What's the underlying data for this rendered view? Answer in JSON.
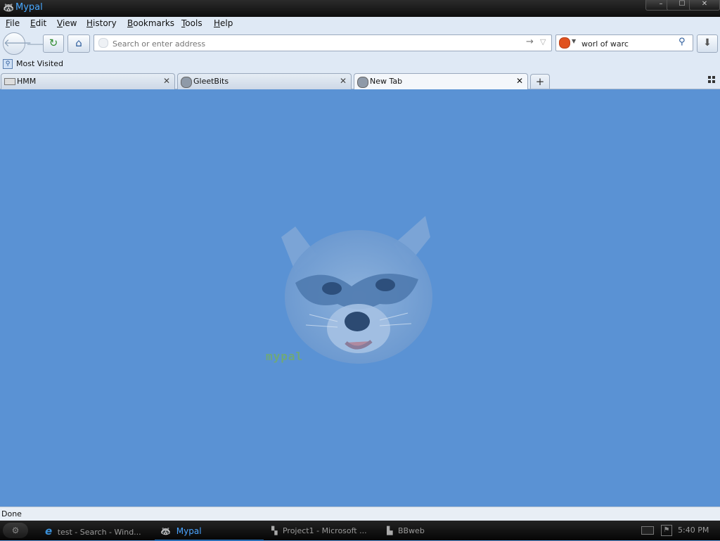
{
  "window": {
    "title": "Mypal",
    "controls": {
      "minimize": "–",
      "maximize": "☐",
      "close": "✕"
    }
  },
  "menubar": {
    "items": [
      {
        "label": "File",
        "accel": "F",
        "rest": "ile"
      },
      {
        "label": "Edit",
        "accel": "E",
        "rest": "dit"
      },
      {
        "label": "View",
        "accel": "V",
        "rest": "iew"
      },
      {
        "label": "History",
        "accel": "H",
        "rest": "istory"
      },
      {
        "label": "Bookmarks",
        "accel": "B",
        "rest": "ookmarks"
      },
      {
        "label": "Tools",
        "accel": "T",
        "rest": "ools"
      },
      {
        "label": "Help",
        "accel": "H",
        "rest": "elp"
      }
    ]
  },
  "toolbar": {
    "back_icon": "back-arrow-icon",
    "forward_icon": "forward-arrow-icon",
    "reload_icon": "reload-icon",
    "home_icon": "home-icon",
    "download_icon": "download-icon"
  },
  "urlbar": {
    "placeholder": "Search or enter address",
    "value": ""
  },
  "searchbar": {
    "value": "worl of warc"
  },
  "bookmarks": {
    "most_visited": "Most Visited"
  },
  "tabs": [
    {
      "label": "HMM",
      "active": false
    },
    {
      "label": "GleetBits",
      "active": false
    },
    {
      "label": "New Tab",
      "active": true
    }
  ],
  "newtab_page": {
    "logo_text": "mypal",
    "background": "#5a92d4"
  },
  "statusbar": {
    "text": "Done"
  },
  "taskbar": {
    "items": [
      {
        "label": "test - Search - Wind..."
      },
      {
        "label": "Mypal",
        "active": true
      },
      {
        "label": "Project1 - Microsoft ..."
      },
      {
        "label": "BBweb"
      }
    ],
    "clock": "5:40 PM"
  },
  "colors": {
    "titlebar_text": "#48a8ff",
    "chrome_bg": "#dfe9f5",
    "content_bg": "#5a92d4"
  }
}
